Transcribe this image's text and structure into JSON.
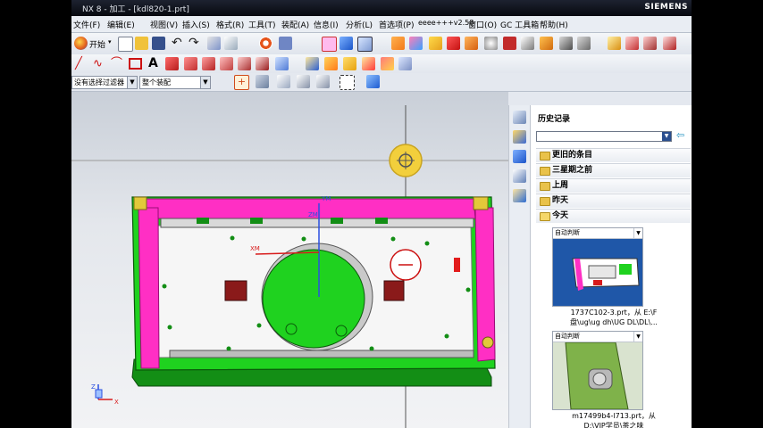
{
  "window": {
    "title": "NX 8 - 加工 - [kdl820-1.prt]",
    "brand": "SIEMENS"
  },
  "menu": {
    "items": [
      "文件(F)",
      "编辑(E)",
      "视图(V)",
      "插入(S)",
      "格式(R)",
      "工具(T)",
      "装配(A)",
      "信息(I)",
      "分析(L)",
      "首选项(P)",
      "eeee+++v2.58",
      "窗口(O)",
      "GC 工具箱",
      "帮助(H)"
    ]
  },
  "toolbar": {
    "start_label": "开始",
    "filter_select": "没有选择过滤器",
    "assembly_select": "整个装配"
  },
  "history_panel": {
    "title": "历史记录",
    "groups": [
      "更旧的条目",
      "三星期之前",
      "上周",
      "昨天",
      "今天"
    ],
    "items": [
      {
        "header": "自动判断",
        "caption_line1": "1737C102-3.prt，从 E:\\F",
        "caption_line2": "盘\\ug\\ug dh\\UG DL\\DL\\..."
      },
      {
        "header": "自动判断",
        "caption_line1": "m17499b4-l713.prt，从",
        "caption_line2": "D:\\VIP学员\\茶之味"
      }
    ]
  },
  "viewport": {
    "axis_labels": {
      "zm": "ZM",
      "ym": "YM",
      "xm": "XM",
      "z": "Z",
      "x": "X"
    }
  },
  "colors": {
    "titlebar": "#0d1018",
    "magenta": "#ff2fc4",
    "green": "#1fd21f",
    "accent": "#2b4f8f"
  }
}
